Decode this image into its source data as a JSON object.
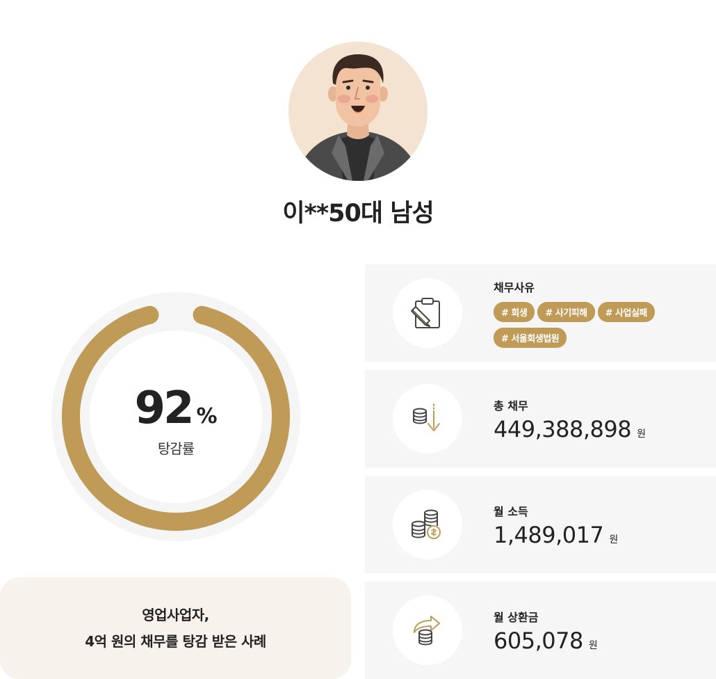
{
  "profile": {
    "name": "이**50대 남성"
  },
  "reduction": {
    "value": "92",
    "unit": "%",
    "label": "탕감률",
    "fraction": 0.92,
    "color": "#c09a57",
    "track_color": "#f5f5f5"
  },
  "summary": {
    "line1": "영업사업자,",
    "line2": "4억 원의 채무를 탕감 받은 사례"
  },
  "cards": {
    "reason": {
      "title": "채무사유",
      "icon": "clipboard-pencil-icon",
      "tags": [
        "# 회생",
        "# 사기피해",
        "# 사업실패",
        "# 서울회생법원"
      ]
    },
    "total_debt": {
      "title": "총 채무",
      "icon": "coins-down-arrow-icon",
      "value": "449,388,898",
      "unit": "원"
    },
    "monthly_income": {
      "title": "월 소득",
      "icon": "coin-stacks-icon",
      "value": "1,489,017",
      "unit": "원"
    },
    "monthly_repayment": {
      "title": "월 상환금",
      "icon": "coins-return-arrow-icon",
      "value": "605,078",
      "unit": "원"
    }
  },
  "colors": {
    "accent": "#c09a57",
    "card_bg": "#f6f6f6",
    "summary_bg": "#f7f3ec"
  }
}
